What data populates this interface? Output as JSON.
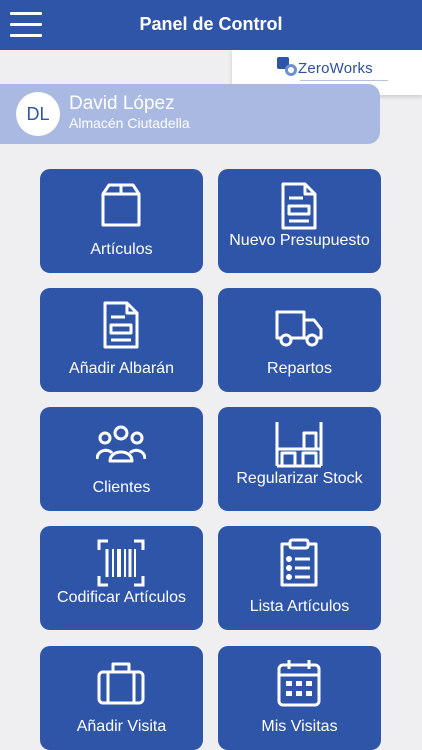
{
  "header": {
    "title": "Panel de Control"
  },
  "brand": {
    "name": "ZeroWorks"
  },
  "user": {
    "initials": "DL",
    "name": "David López",
    "location": "Almacén Ciutadella"
  },
  "tiles": [
    {
      "label": "Artículos",
      "icon": "box-icon"
    },
    {
      "label": "Nuevo Presupuesto",
      "icon": "document-icon"
    },
    {
      "label": "Añadir Albarán",
      "icon": "document-icon"
    },
    {
      "label": "Repartos",
      "icon": "truck-icon"
    },
    {
      "label": "Clientes",
      "icon": "users-icon"
    },
    {
      "label": "Regularizar Stock",
      "icon": "shelves-icon"
    },
    {
      "label": "Codificar Artículos",
      "icon": "barcode-icon"
    },
    {
      "label": "Lista Artículos",
      "icon": "clipboard-list-icon"
    },
    {
      "label": "Añadir Visita",
      "icon": "briefcase-icon"
    },
    {
      "label": "Mis Visitas",
      "icon": "calendar-icon"
    }
  ],
  "colors": {
    "primary": "#2f55a9",
    "card": "#a9b9e2",
    "background": "#efeff1"
  }
}
